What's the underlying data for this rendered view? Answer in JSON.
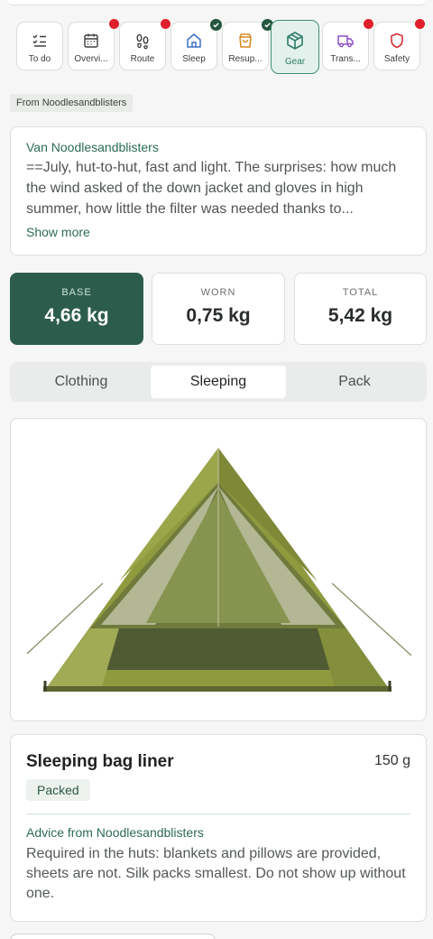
{
  "tabs": [
    {
      "label": "To do",
      "icon": "checklist-icon",
      "badge": "none"
    },
    {
      "label": "Overvi...",
      "icon": "calendar-icon",
      "badge": "alert"
    },
    {
      "label": "Route",
      "icon": "footprints-icon",
      "badge": "alert"
    },
    {
      "label": "Sleep",
      "icon": "home-icon",
      "badge": "done"
    },
    {
      "label": "Resup...",
      "icon": "shopping-bag-icon",
      "badge": "done"
    },
    {
      "label": "Gear",
      "icon": "package-icon",
      "badge": "none",
      "active": true
    },
    {
      "label": "Trans...",
      "icon": "truck-icon",
      "badge": "alert"
    },
    {
      "label": "Safety",
      "icon": "shield-icon",
      "badge": "alert"
    }
  ],
  "from_chip": "From Noodlesandblisters",
  "note": {
    "author": "Van Noodlesandblisters",
    "body": "==July, hut-to-hut, fast and light. The surprises: how much the wind asked of the down jacket and gloves in high summer, how little the filter was needed thanks to...",
    "more": "Show more"
  },
  "stats": [
    {
      "label": "BASE",
      "value": "4,66 kg"
    },
    {
      "label": "WORN",
      "value": "0,75 kg"
    },
    {
      "label": "TOTAL",
      "value": "5,42 kg"
    }
  ],
  "categories": {
    "options": [
      "Clothing",
      "Sleeping",
      "Pack"
    ],
    "selected": "Sleeping"
  },
  "item": {
    "name": "Sleeping bag liner",
    "weight": "150 g",
    "status": "Packed",
    "advice_heading": "Advice from Noodlesandblisters",
    "advice": "Required in the huts: blankets and pillows are provided, sheets are not. Silk packs smallest. Do not show up without one."
  },
  "colors": {
    "accent": "#2c5d4c",
    "alert": "#e2202b",
    "done": "#24563f"
  }
}
